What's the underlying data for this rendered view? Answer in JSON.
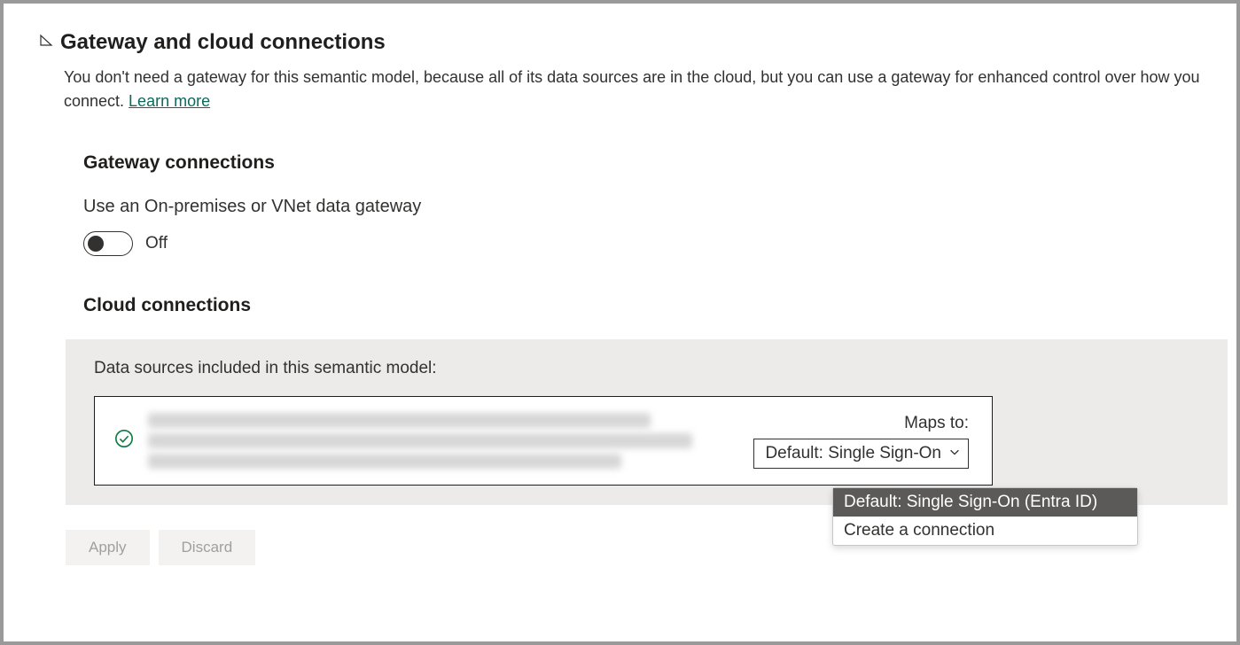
{
  "header": {
    "title": "Gateway and cloud connections",
    "description": "You don't need a gateway for this semantic model, because all of its data sources are in the cloud, but you can use a gateway for enhanced control over how you connect. ",
    "learn_more": "Learn more"
  },
  "gateway_section": {
    "heading": "Gateway connections",
    "toggle_label": "Use an On-premises or VNet data gateway",
    "toggle_state": "Off"
  },
  "cloud_section": {
    "heading": "Cloud connections",
    "panel_description": "Data sources included in this semantic model:",
    "maps_to_label": "Maps to:",
    "dropdown_selected": "Default: Single Sign-On",
    "dropdown_options": {
      "opt0": "Default: Single Sign-On (Entra ID)",
      "opt1": "Create a connection"
    }
  },
  "buttons": {
    "apply": "Apply",
    "discard": "Discard"
  }
}
